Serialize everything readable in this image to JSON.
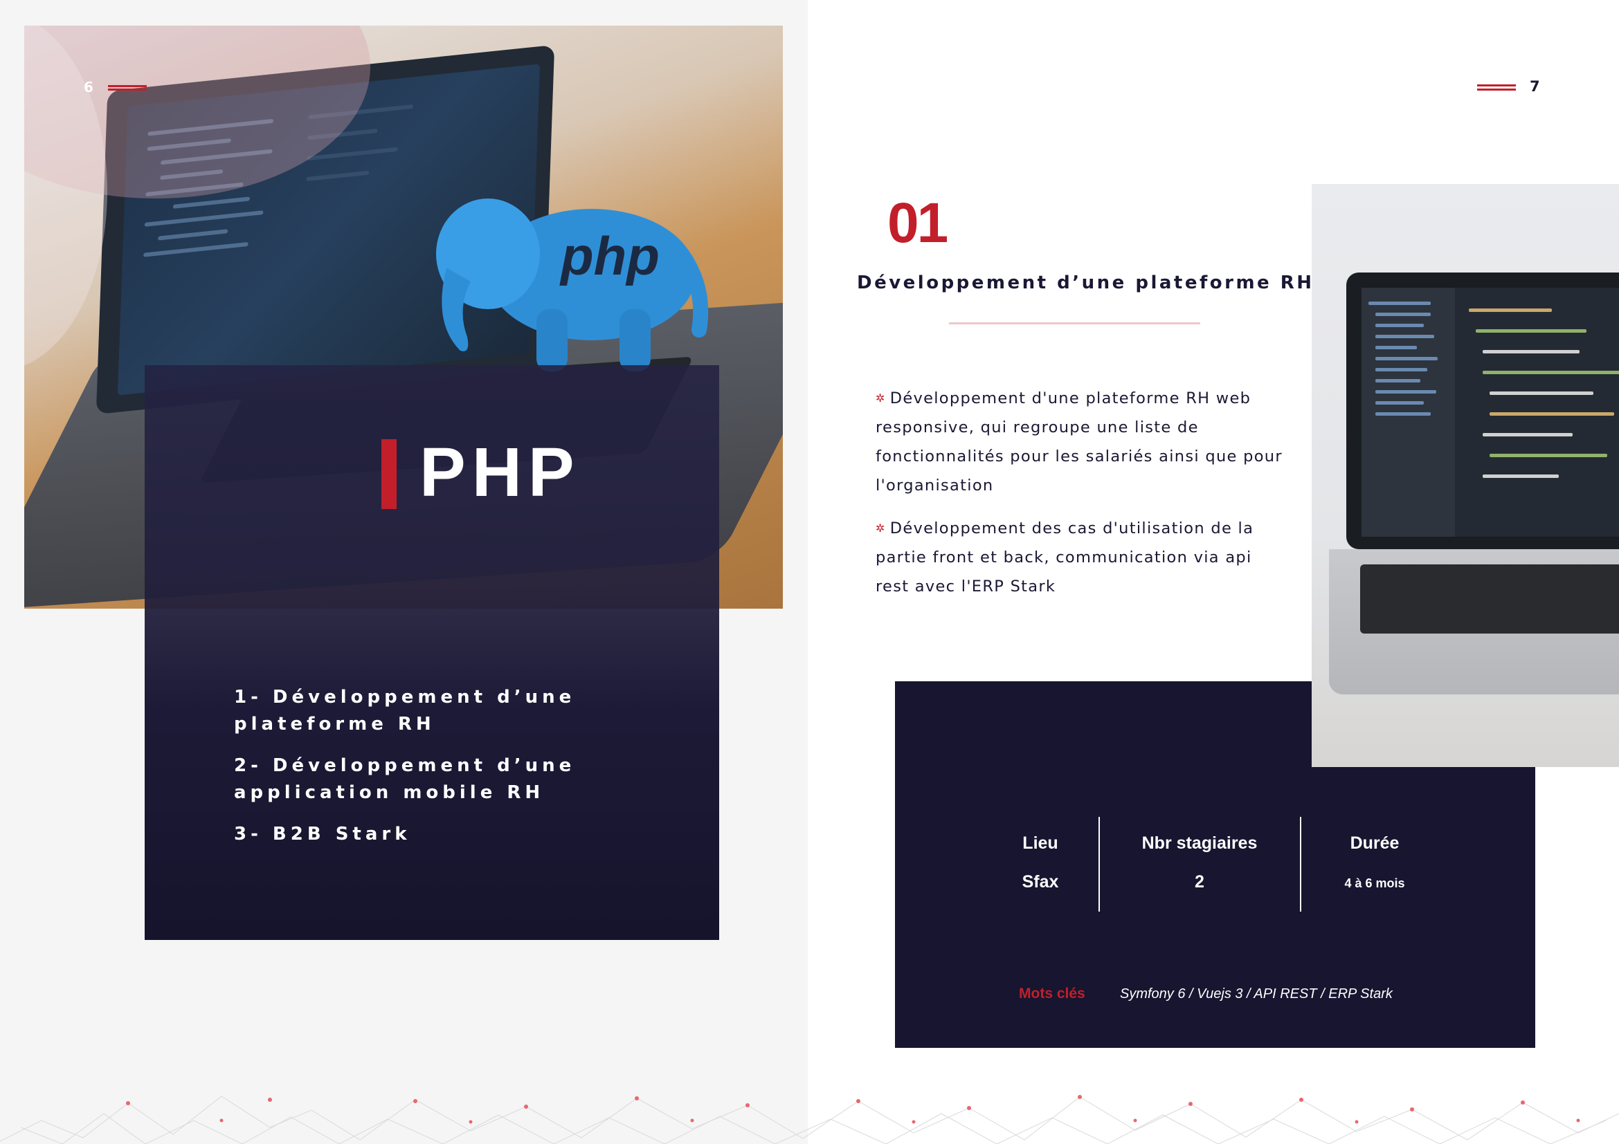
{
  "pages": {
    "left_number": "6",
    "right_number": "7"
  },
  "hero": {
    "title": "PHP",
    "image_text": "php"
  },
  "projects": [
    "1- Développement d’une plateforme RH",
    "2- Développement d’une application mobile RH",
    "3- B2B Stark"
  ],
  "section": {
    "number": "01",
    "title": "Développement d’une plateforme RH",
    "bullets": [
      "Développement d'une plateforme RH web responsive, qui regroupe une liste de fonctionnalités pour les salariés ainsi que pour l'organisation",
      "Développement des cas d'utilisation de la partie front et back, communication via api rest avec l'ERP Stark"
    ]
  },
  "info": {
    "columns": [
      {
        "label": "Lieu",
        "value": "Sfax"
      },
      {
        "label": "Nbr stagiaires",
        "value": "2"
      },
      {
        "label": "Durée",
        "value": "4 à 6  mois"
      }
    ],
    "keywords_label": "Mots clés",
    "keywords": "Symfony 6 / Vuejs 3 / API REST / ERP Stark"
  },
  "colors": {
    "accent": "#c21f2b",
    "navy": "#17152f",
    "rule": "#f1c6c9"
  },
  "icons": {
    "bullet": "star-bullet-icon"
  }
}
